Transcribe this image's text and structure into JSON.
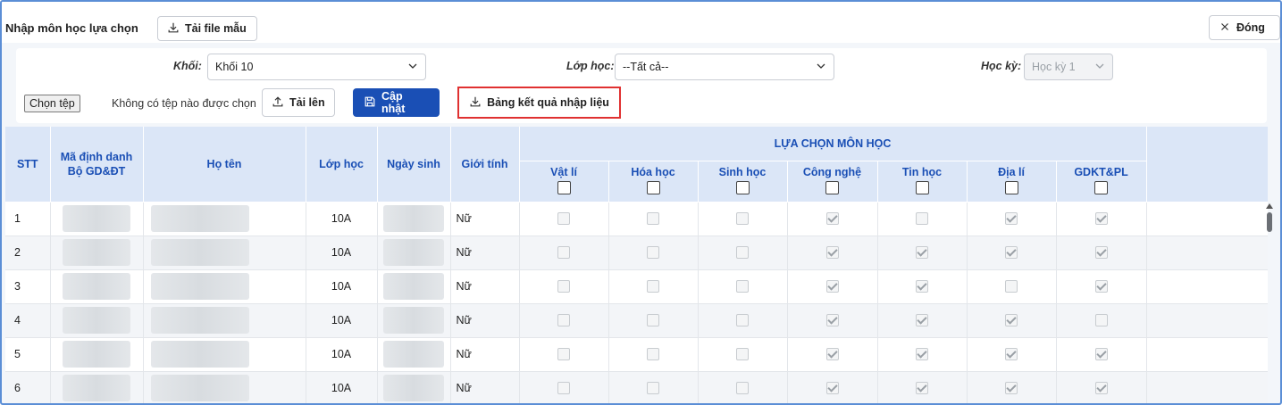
{
  "header": {
    "title": "Nhập môn học lựa chọn",
    "download_template_label": "Tải file mẫu",
    "close_label": "Đóng"
  },
  "filters": {
    "khoi_label": "Khối:",
    "khoi_value": "Khối 10",
    "lop_label": "Lớp học:",
    "lop_value": "--Tất cả--",
    "hocky_label": "Học kỳ:",
    "hocky_value": "Học kỳ 1"
  },
  "actions": {
    "choose_file_label": "Chọn tệp",
    "no_file_text": "Không có tệp nào được chọn",
    "upload_label": "Tải lên",
    "update_label": "Cập nhật",
    "result_label": "Bảng kết quả nhập liệu"
  },
  "table": {
    "headers": {
      "stt": "STT",
      "ma_dinh_danh": "Mã định danh\nBộ GD&ĐT",
      "ho_ten": "Họ tên",
      "lop_hoc": "Lớp học",
      "ngay_sinh": "Ngày sinh",
      "gioi_tinh": "Giới tính",
      "group": "LỰA CHỌN MÔN HỌC"
    },
    "subjects": [
      "Vật lí",
      "Hóa học",
      "Sinh học",
      "Công nghệ",
      "Tin học",
      "Địa lí",
      "GDKT&PL"
    ],
    "rows": [
      {
        "stt": "1",
        "lop": "10A",
        "gioi_tinh": "Nữ",
        "checks": [
          false,
          false,
          false,
          true,
          false,
          true,
          true
        ]
      },
      {
        "stt": "2",
        "lop": "10A",
        "gioi_tinh": "Nữ",
        "checks": [
          false,
          false,
          false,
          true,
          true,
          true,
          true
        ]
      },
      {
        "stt": "3",
        "lop": "10A",
        "gioi_tinh": "Nữ",
        "checks": [
          false,
          false,
          false,
          true,
          true,
          false,
          true
        ]
      },
      {
        "stt": "4",
        "lop": "10A",
        "gioi_tinh": "Nữ",
        "checks": [
          false,
          false,
          false,
          true,
          true,
          true,
          false
        ]
      },
      {
        "stt": "5",
        "lop": "10A",
        "gioi_tinh": "Nữ",
        "checks": [
          false,
          false,
          false,
          true,
          true,
          true,
          true
        ]
      },
      {
        "stt": "6",
        "lop": "10A",
        "gioi_tinh": "Nữ",
        "checks": [
          false,
          false,
          false,
          true,
          true,
          true,
          true
        ]
      }
    ]
  }
}
